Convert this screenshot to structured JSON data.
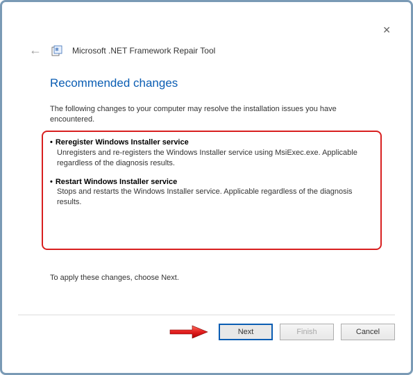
{
  "window": {
    "app_title": "Microsoft .NET Framework Repair Tool"
  },
  "page": {
    "heading": "Recommended changes",
    "intro": "The following changes to your computer may resolve the installation issues you have encountered.",
    "apply_text": "To apply these changes, choose Next."
  },
  "changes": [
    {
      "title": "Reregister Windows Installer service",
      "desc": "Unregisters and re-registers the Windows Installer service using MsiExec.exe. Applicable regardless of the diagnosis results."
    },
    {
      "title": "Restart Windows Installer service",
      "desc": "Stops and restarts the Windows Installer service. Applicable regardless of the diagnosis results."
    }
  ],
  "buttons": {
    "next": "Next",
    "finish": "Finish",
    "cancel": "Cancel"
  }
}
